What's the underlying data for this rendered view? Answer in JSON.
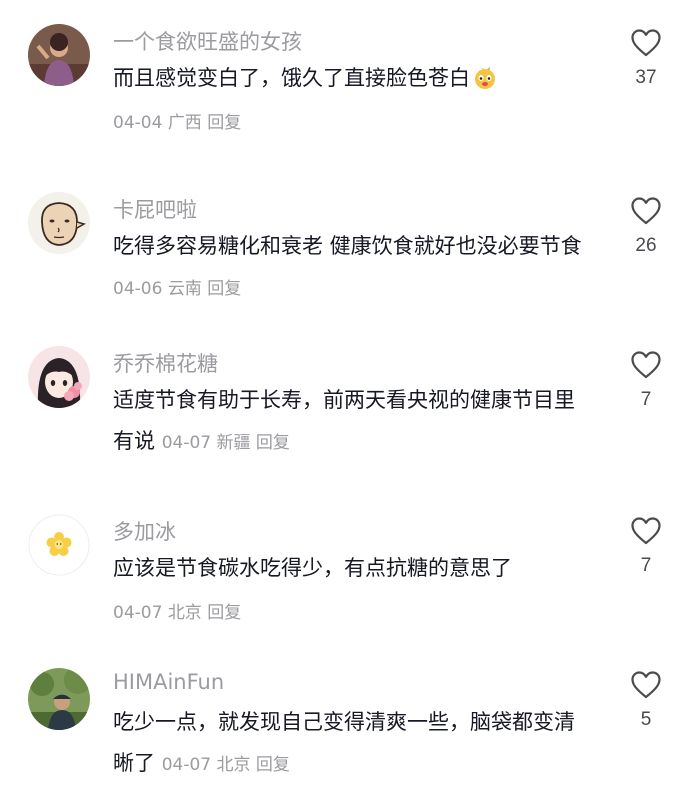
{
  "comments": [
    {
      "username": "一个食欲旺盛的女孩",
      "text": "而且感觉变白了，饿久了直接脸色苍白",
      "date": "04-04",
      "location": "广西",
      "reply_label": "回复",
      "likes": "37",
      "avatar_icon": "user-photo-avatar",
      "emoji_icon": "dog-face-emoji"
    },
    {
      "username": "卡屁吧啦",
      "text": "吃得多容易糖化和衰老 健康饮食就好也没必要节食",
      "date": "04-06",
      "location": "云南",
      "reply_label": "回复",
      "likes": "26",
      "avatar_icon": "cartoon-face-avatar"
    },
    {
      "username": "乔乔棉花糖",
      "text": "适度节食有助于长寿，前两天看央视的健康节目里有说",
      "date": "04-07",
      "location": "新疆",
      "reply_label": "回复",
      "likes": "7",
      "avatar_icon": "anime-girl-avatar"
    },
    {
      "username": "多加冰",
      "text": "应该是节食碳水吃得少，有点抗糖的意思了",
      "date": "04-07",
      "location": "北京",
      "reply_label": "回复",
      "likes": "7",
      "avatar_icon": "flower-avatar"
    },
    {
      "username": "HIMAinFun",
      "text": "吃少一点，就发现自己变得清爽一些，脑袋都变清晰了",
      "date": "04-07",
      "location": "北京",
      "reply_label": "回复",
      "likes": "5",
      "avatar_icon": "outdoor-person-avatar"
    }
  ],
  "heart_icon": "heart-outline-icon"
}
